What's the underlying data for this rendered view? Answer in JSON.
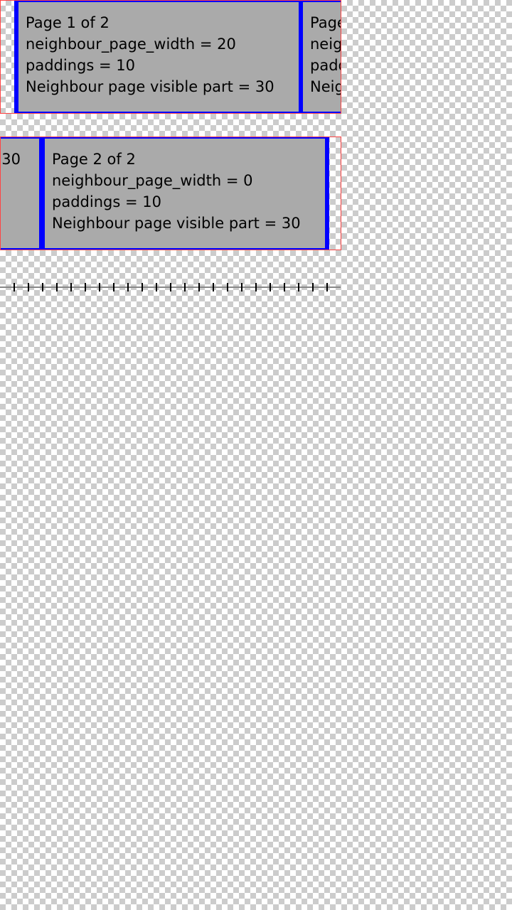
{
  "carousels": [
    {
      "current_page": {
        "lines": [
          "Page 1 of 2",
          "neighbour_page_width = 20",
          "paddings = 10",
          "Neighbour page visible part = 30"
        ]
      },
      "next_page_visible": {
        "lines": [
          "Page",
          "neig",
          "padd",
          "Neig"
        ]
      }
    },
    {
      "prev_page_visible": {
        "lines": [
          "",
          "",
          "",
          "30"
        ]
      },
      "current_page": {
        "lines": [
          "Page 2 of 2",
          "neighbour_page_width = 0",
          "paddings = 10",
          "Neighbour page visible part = 30"
        ]
      }
    }
  ],
  "ruler": {
    "tick_count": 23,
    "tick_spacing_units": 20,
    "first_tick_units": 20
  },
  "colors": {
    "page_fill": "#aaaaaa",
    "page_border": "#0000ff",
    "frame_border": "#ff4444"
  }
}
